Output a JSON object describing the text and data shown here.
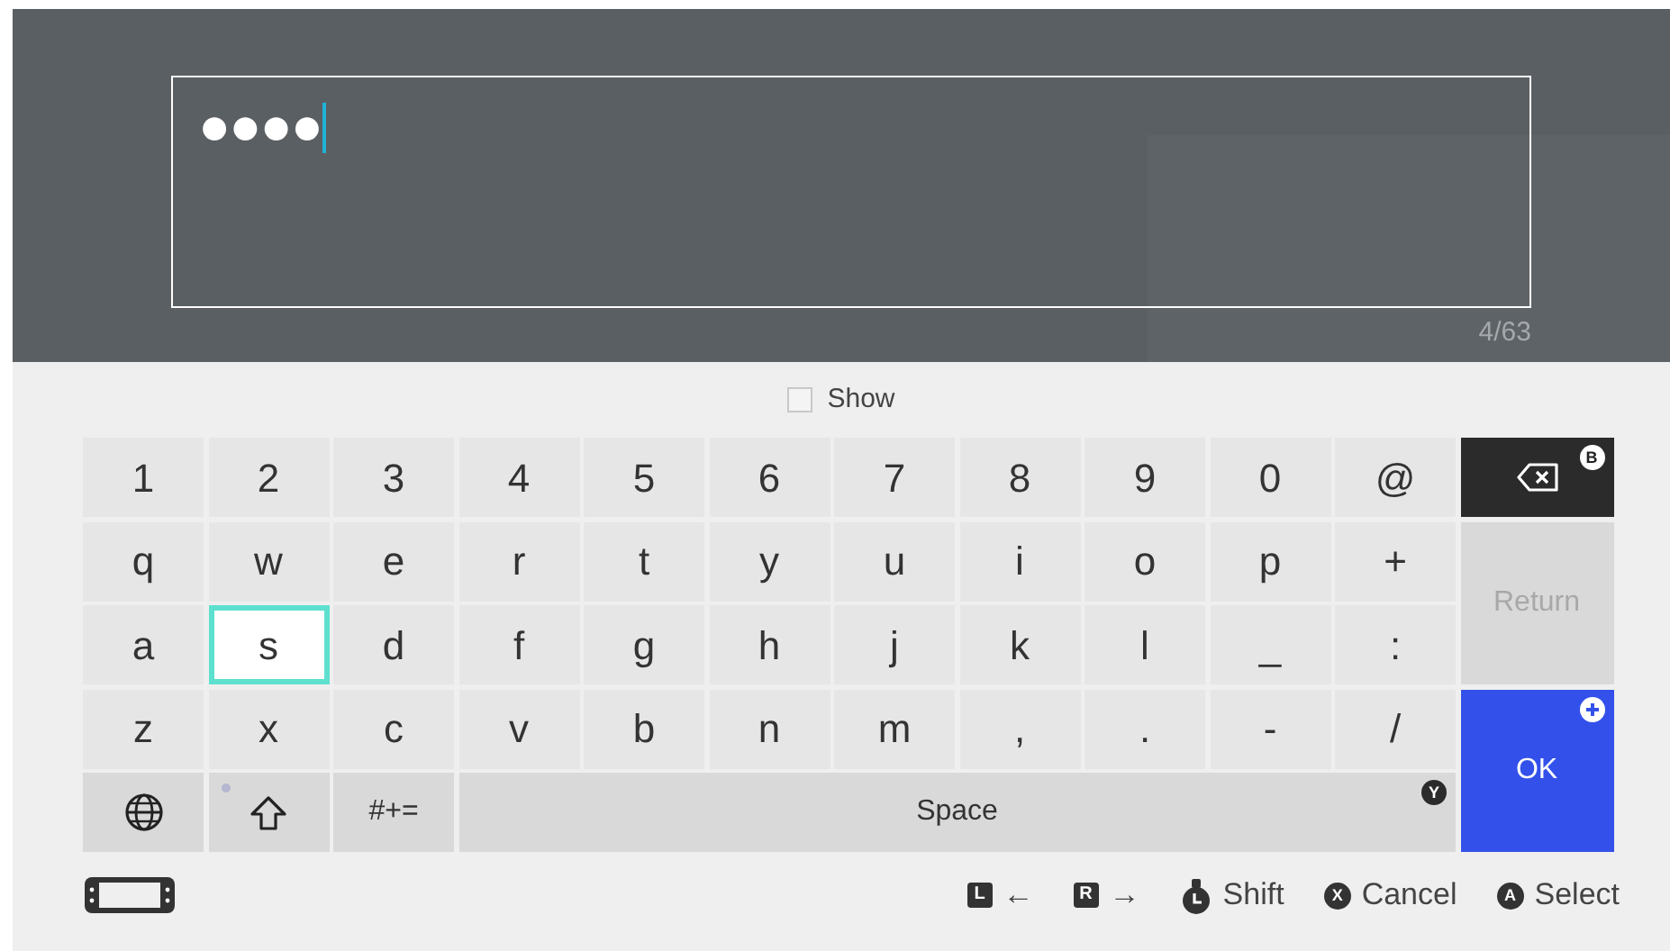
{
  "input": {
    "value": "●●●●",
    "counter": "4/63"
  },
  "show_toggle": {
    "label": "Show",
    "checked": false
  },
  "keyboard": {
    "rows": [
      [
        {
          "kind": "char",
          "label": "1",
          "selected": false
        },
        {
          "kind": "char",
          "label": "2",
          "selected": false
        },
        {
          "kind": "char",
          "label": "3",
          "selected": false
        },
        {
          "kind": "char",
          "label": "4",
          "selected": false
        },
        {
          "kind": "char",
          "label": "5",
          "selected": false
        },
        {
          "kind": "char",
          "label": "6",
          "selected": false
        },
        {
          "kind": "char",
          "label": "7",
          "selected": false
        },
        {
          "kind": "char",
          "label": "8",
          "selected": false
        },
        {
          "kind": "char",
          "label": "9",
          "selected": false
        },
        {
          "kind": "char",
          "label": "0",
          "selected": false
        },
        {
          "kind": "char",
          "label": "@",
          "selected": false
        }
      ],
      [
        {
          "kind": "char",
          "label": "q",
          "selected": false
        },
        {
          "kind": "char",
          "label": "w",
          "selected": false
        },
        {
          "kind": "char",
          "label": "e",
          "selected": false
        },
        {
          "kind": "char",
          "label": "r",
          "selected": false
        },
        {
          "kind": "char",
          "label": "t",
          "selected": false
        },
        {
          "kind": "char",
          "label": "y",
          "selected": false
        },
        {
          "kind": "char",
          "label": "u",
          "selected": false
        },
        {
          "kind": "char",
          "label": "i",
          "selected": false
        },
        {
          "kind": "char",
          "label": "o",
          "selected": false
        },
        {
          "kind": "char",
          "label": "p",
          "selected": false
        },
        {
          "kind": "char",
          "label": "+",
          "selected": false
        }
      ],
      [
        {
          "kind": "char",
          "label": "a",
          "selected": false
        },
        {
          "kind": "char",
          "label": "s",
          "selected": true
        },
        {
          "kind": "char",
          "label": "d",
          "selected": false
        },
        {
          "kind": "char",
          "label": "f",
          "selected": false
        },
        {
          "kind": "char",
          "label": "g",
          "selected": false
        },
        {
          "kind": "char",
          "label": "h",
          "selected": false
        },
        {
          "kind": "char",
          "label": "j",
          "selected": false
        },
        {
          "kind": "char",
          "label": "k",
          "selected": false
        },
        {
          "kind": "char",
          "label": "l",
          "selected": false
        },
        {
          "kind": "char",
          "label": "_",
          "selected": false
        },
        {
          "kind": "char",
          "label": ":",
          "selected": false
        }
      ],
      [
        {
          "kind": "char",
          "label": "z",
          "selected": false
        },
        {
          "kind": "char",
          "label": "x",
          "selected": false
        },
        {
          "kind": "char",
          "label": "c",
          "selected": false
        },
        {
          "kind": "char",
          "label": "v",
          "selected": false
        },
        {
          "kind": "char",
          "label": "b",
          "selected": false
        },
        {
          "kind": "char",
          "label": "n",
          "selected": false
        },
        {
          "kind": "char",
          "label": "m",
          "selected": false
        },
        {
          "kind": "char",
          "label": ",",
          "selected": false
        },
        {
          "kind": "char",
          "label": ".",
          "selected": false
        },
        {
          "kind": "char",
          "label": "-",
          "selected": false
        },
        {
          "kind": "char",
          "label": "/",
          "selected": false
        }
      ]
    ],
    "bottom_keys": [
      {
        "kind": "globe",
        "selected": false
      },
      {
        "kind": "shift",
        "selected": false
      },
      {
        "kind": "char",
        "label": "#+=",
        "selected": false
      },
      {
        "kind": "space",
        "label": "Space",
        "button": "Y",
        "selected": false
      }
    ],
    "side_keys": [
      {
        "kind": "backspace",
        "button": "B"
      },
      {
        "kind": "return",
        "label": "Return",
        "disabled": true
      },
      {
        "kind": "ok",
        "label": "OK",
        "disabled": false
      }
    ]
  },
  "hints": [
    {
      "kind": "button",
      "button": "L",
      "label": "←"
    },
    {
      "kind": "button",
      "button": "R",
      "label": "→"
    },
    {
      "kind": "stick",
      "label": "Shift"
    },
    {
      "kind": "round",
      "button": "X",
      "label": "Cancel"
    },
    {
      "kind": "round",
      "button": "A",
      "label": "Select"
    }
  ]
}
